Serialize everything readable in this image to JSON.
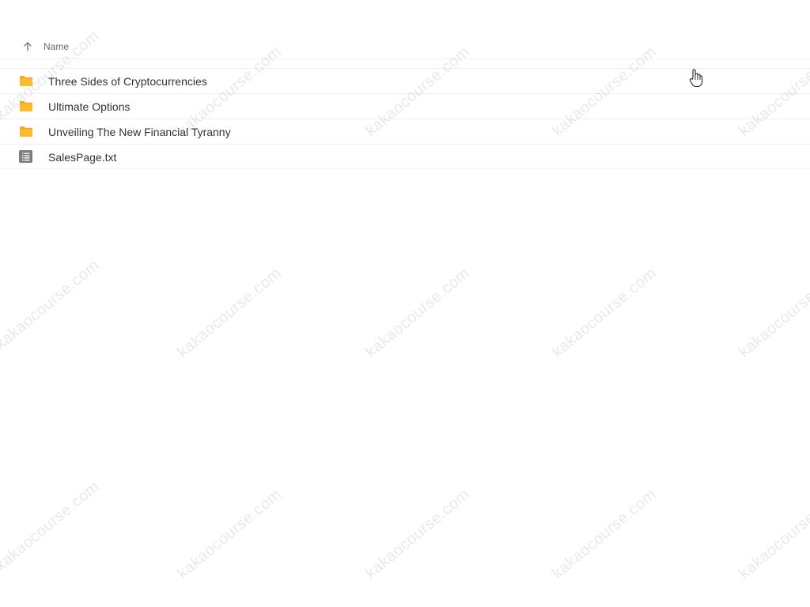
{
  "list": {
    "header": {
      "name_label": "Name",
      "sort_icon": "arrow-up-icon"
    },
    "items": [
      {
        "name": "Three Sides of Cryptocurrencies",
        "type": "folder",
        "icon": "folder-icon",
        "icon_color": "#f5a623"
      },
      {
        "name": "Ultimate Options",
        "type": "folder",
        "icon": "folder-icon",
        "icon_color": "#f5a623"
      },
      {
        "name": "Unveiling The New Financial Tyranny",
        "type": "folder",
        "icon": "folder-icon",
        "icon_color": "#f5a623"
      },
      {
        "name": "SalesPage.txt",
        "type": "file",
        "icon": "text-file-icon",
        "icon_color": "#7a7a7a"
      }
    ]
  },
  "watermark": {
    "text": "kakaocourse.com"
  },
  "cursor": {
    "icon": "hand-pointer-icon"
  }
}
